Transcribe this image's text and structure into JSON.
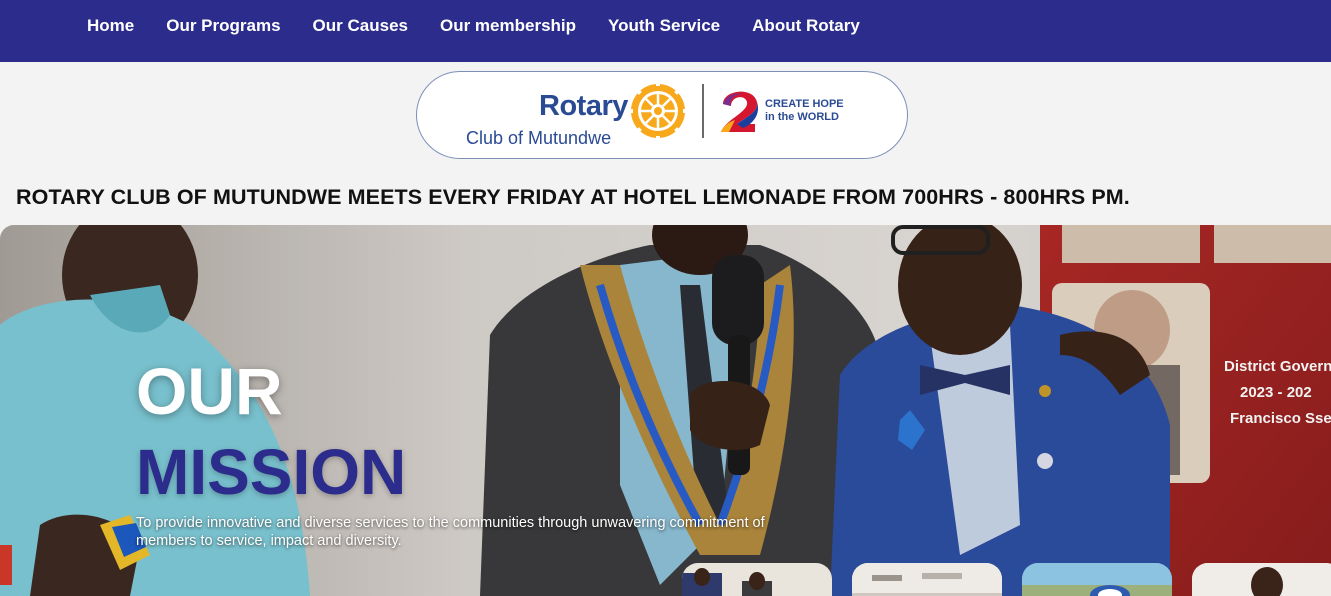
{
  "nav": {
    "items": [
      {
        "label": "Home"
      },
      {
        "label": "Our Programs"
      },
      {
        "label": "Our Causes"
      },
      {
        "label": "Our membership"
      },
      {
        "label": "Youth Service"
      },
      {
        "label": "About Rotary"
      }
    ]
  },
  "logo": {
    "brand": "Rotary",
    "club": "Club of Mutundwe",
    "slogan_line1": "CREATE HOPE",
    "slogan_line2": "in the WORLD"
  },
  "banner": {
    "text": "ROTARY CLUB OF MUTUNDWE MEETS EVERY FRIDAY AT HOTEL LEMONADE FROM 700HRS - 800HRS PM."
  },
  "hero": {
    "title_line1": "OUR",
    "title_line2": "MISSION",
    "description": "To provide innovative and diverse services to the communities through unwavering commitment of members to service, impact and diversity.",
    "poster_text_1": "District Governo",
    "poster_text_2": "2023 - 202",
    "poster_text_3": "Francisco Ssen"
  },
  "colors": {
    "nav_bg": "#2c2c8d",
    "brand_blue": "#2a4b94",
    "rotary_gold": "#f7a81b",
    "mission_blue": "#2c2c8d"
  },
  "icons": {
    "rotary_wheel": "rotary-wheel-logo",
    "hope_swirl": "create-hope-swirl-logo"
  }
}
